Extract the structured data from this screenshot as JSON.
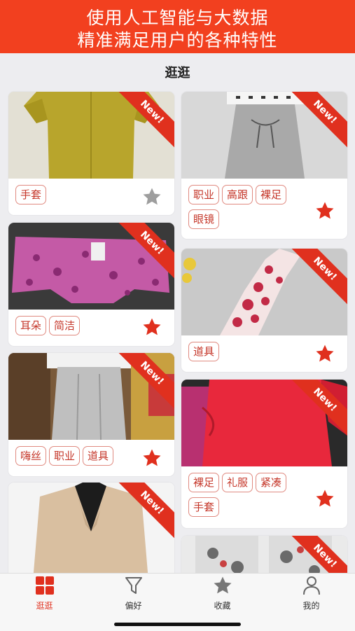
{
  "banner": {
    "line1": "使用人工智能与大数据",
    "line2": "精准满足用户的各种特性"
  },
  "page_title": "逛逛",
  "colors": {
    "accent": "#e0301e",
    "banner_bg": "#f2401f",
    "star_active": "#e0301e",
    "star_inactive": "#9e9e9e"
  },
  "badge_text": "New!",
  "cards": [
    {
      "tags": [
        "手套"
      ],
      "favorited": false,
      "image": "mustard-ruffle-dress"
    },
    {
      "tags": [
        "耳朵",
        "简洁"
      ],
      "favorited": true,
      "image": "pink-floral-shorts"
    },
    {
      "tags": [
        "嗨丝",
        "职业",
        "道具"
      ],
      "favorited": true,
      "image": "grey-dress-on-hanger"
    },
    {
      "tags": [],
      "favorited": false,
      "image": "beige-blazer"
    },
    {
      "tags": [
        "职业",
        "高跟",
        "裸足",
        "眼镜"
      ],
      "favorited": true,
      "image": "grey-sleeveless-dress"
    },
    {
      "tags": [
        "道具"
      ],
      "favorited": true,
      "image": "red-patterned-qipao"
    },
    {
      "tags": [
        "裸足",
        "礼服",
        "紧凑",
        "手套"
      ],
      "favorited": true,
      "image": "red-ruffle-dress"
    },
    {
      "tags": [],
      "favorited": false,
      "image": "floral-print-dresses"
    }
  ],
  "tabbar": [
    {
      "label": "逛逛",
      "icon": "grid-icon",
      "active": true
    },
    {
      "label": "偏好",
      "icon": "filter-icon",
      "active": false
    },
    {
      "label": "收藏",
      "icon": "star-icon",
      "active": false
    },
    {
      "label": "我的",
      "icon": "person-icon",
      "active": false
    }
  ]
}
